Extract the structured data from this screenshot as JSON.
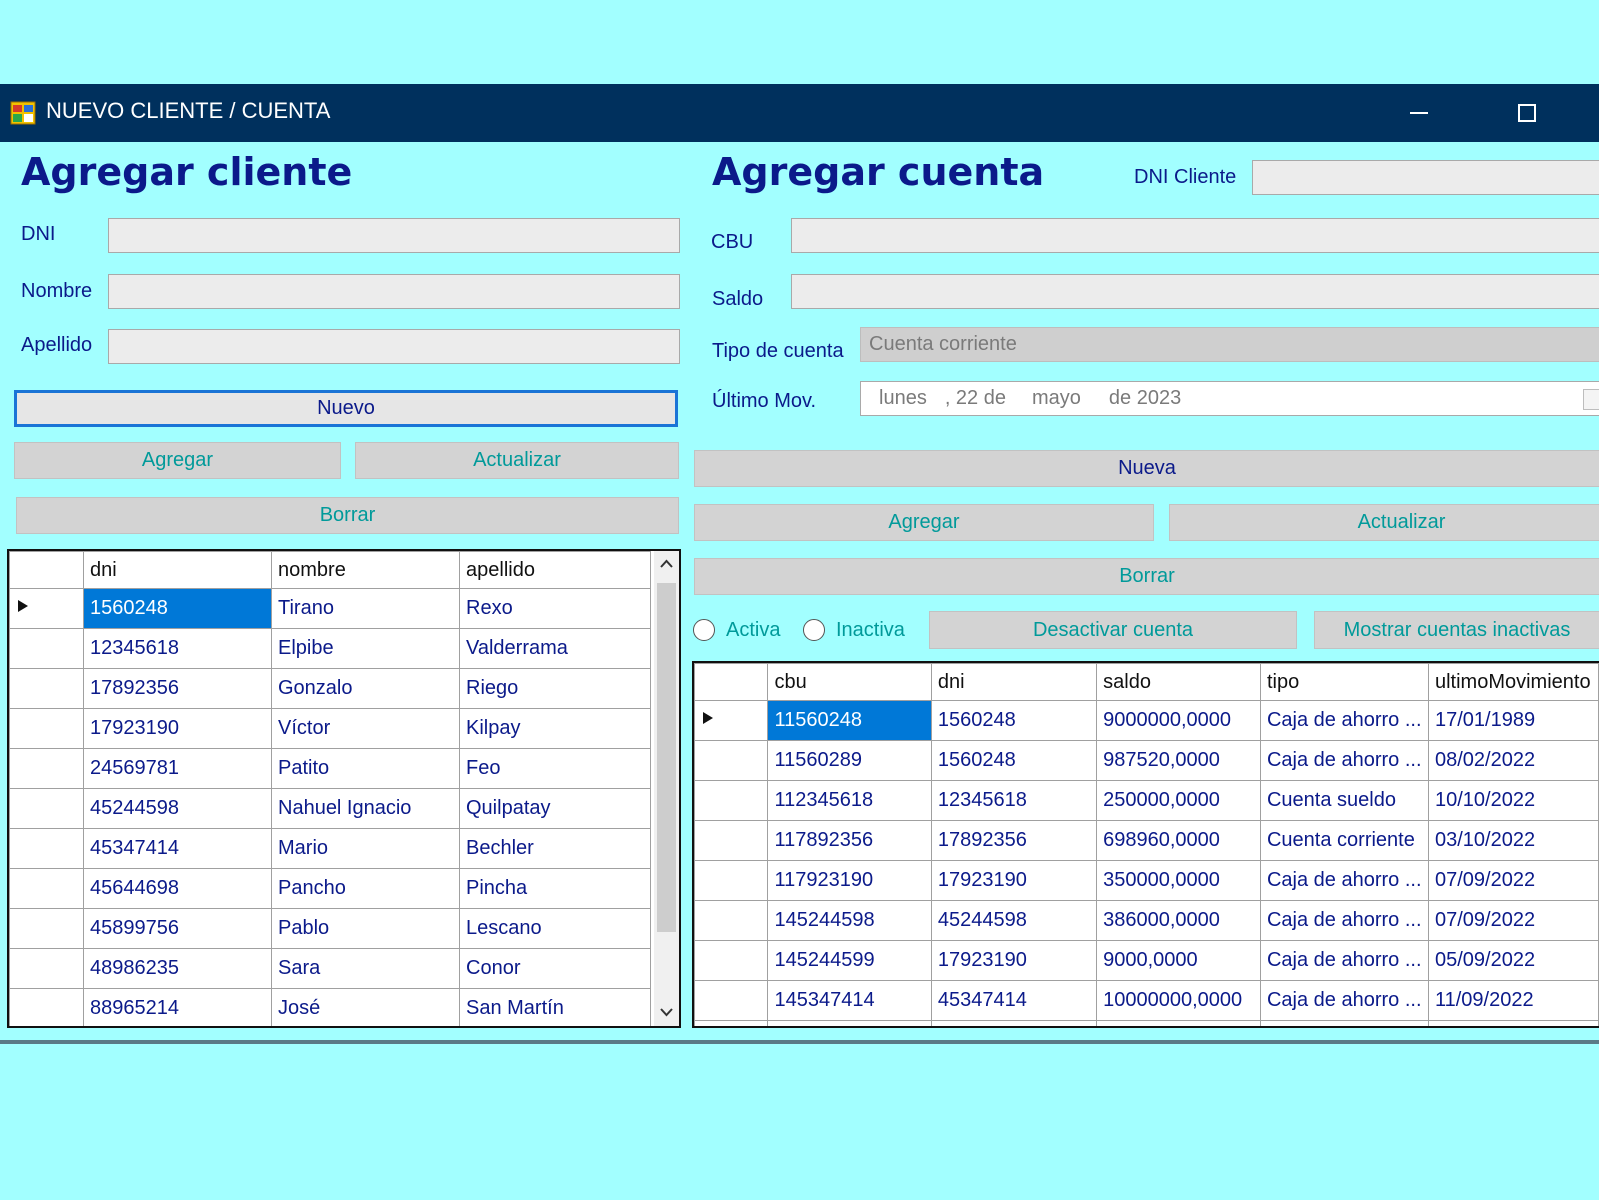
{
  "window": {
    "title": "NUEVO CLIENTE / CUENTA"
  },
  "cliente": {
    "heading": "Agregar cliente",
    "labels": {
      "dni": "DNI",
      "nombre": "Nombre",
      "apellido": "Apellido"
    },
    "values": {
      "dni": "",
      "nombre": "",
      "apellido": ""
    },
    "buttons": {
      "nuevo": "Nuevo",
      "agregar": "Agregar",
      "actualizar": "Actualizar",
      "borrar": "Borrar"
    },
    "grid": {
      "columns": [
        "dni",
        "nombre",
        "apellido"
      ],
      "rows": [
        [
          "1560248",
          "Tirano",
          "Rexo"
        ],
        [
          "12345618",
          "Elpibe",
          "Valderrama"
        ],
        [
          "17892356",
          "Gonzalo",
          "Riego"
        ],
        [
          "17923190",
          "Víctor",
          "Kilpay"
        ],
        [
          "24569781",
          "Patito",
          "Feo"
        ],
        [
          "45244598",
          "Nahuel Ignacio",
          "Quilpatay"
        ],
        [
          "45347414",
          "Mario",
          "Bechler"
        ],
        [
          "45644698",
          "Pancho",
          "Pincha"
        ],
        [
          "45899756",
          "Pablo",
          "Lescano"
        ],
        [
          "48986235",
          "Sara",
          "Conor"
        ],
        [
          "88965214",
          "José",
          "San Martín"
        ]
      ]
    }
  },
  "cuenta": {
    "heading": "Agregar cuenta",
    "labels": {
      "dni_cliente": "DNI Cliente",
      "cbu": "CBU",
      "saldo": "Saldo",
      "tipo": "Tipo de cuenta",
      "ultimo_mov": "Último Mov."
    },
    "values": {
      "dni_cliente": "",
      "cbu": "",
      "saldo": "",
      "tipo": "Cuenta corriente"
    },
    "date": {
      "weekday": "lunes",
      "day": ", 22 de",
      "month": "mayo",
      "year": "de 2023"
    },
    "buttons": {
      "nueva": "Nueva",
      "agregar": "Agregar",
      "actualizar": "Actualizar",
      "borrar": "Borrar",
      "desactivar": "Desactivar cuenta",
      "mostrar_inactivas": "Mostrar cuentas inactivas"
    },
    "radios": {
      "activa": "Activa",
      "inactiva": "Inactiva"
    },
    "grid": {
      "columns": [
        "cbu",
        "dni",
        "saldo",
        "tipo",
        "ultimoMovimiento"
      ],
      "rows": [
        [
          "11560248",
          "1560248",
          "9000000,0000",
          "Caja de ahorro ...",
          "17/01/1989"
        ],
        [
          "11560289",
          "1560248",
          "987520,0000",
          "Caja de ahorro ...",
          "08/02/2022"
        ],
        [
          "112345618",
          "12345618",
          "250000,0000",
          "Cuenta sueldo",
          "10/10/2022"
        ],
        [
          "117892356",
          "17892356",
          "698960,0000",
          "Cuenta corriente",
          "03/10/2022"
        ],
        [
          "117923190",
          "17923190",
          "350000,0000",
          "Caja de ahorro ...",
          "07/09/2022"
        ],
        [
          "145244598",
          "45244598",
          "386000,0000",
          "Caja de ahorro ...",
          "07/09/2022"
        ],
        [
          "145244599",
          "17923190",
          "9000,0000",
          "Caja de ahorro ...",
          "05/09/2022"
        ],
        [
          "145347414",
          "45347414",
          "10000000,0000",
          "Caja de ahorro ...",
          "11/09/2022"
        ]
      ]
    }
  }
}
